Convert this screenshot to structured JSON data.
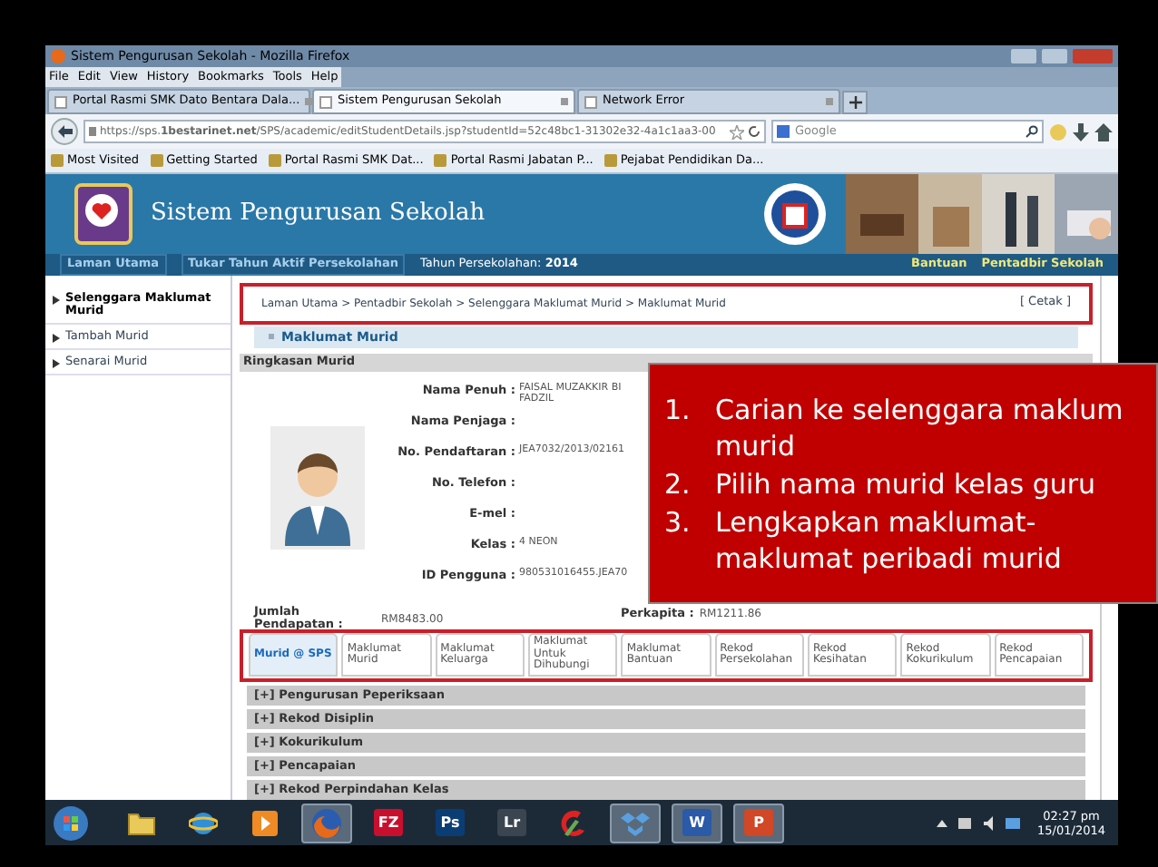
{
  "window": {
    "title": "Sistem Pengurusan Sekolah - Mozilla Firefox"
  },
  "menu": [
    "File",
    "Edit",
    "View",
    "History",
    "Bookmarks",
    "Tools",
    "Help"
  ],
  "browser_tabs": [
    {
      "label": "Portal Rasmi SMK Dato Bentara Dala...",
      "selected": false
    },
    {
      "label": "Sistem Pengurusan Sekolah",
      "selected": true
    },
    {
      "label": "Network Error",
      "selected": false
    }
  ],
  "address": {
    "value": "https://sps.**1bestarinet.net**/SPS/academic/editStudentDetails.jsp?studentId=52c48bc1-31302e32-4a1c1aa3-00"
  },
  "search": {
    "placeholder": "Google"
  },
  "bookmarks": [
    "Most Visited",
    "Getting Started",
    "Portal Rasmi SMK Dat...",
    "Portal Rasmi Jabatan P...",
    "Pejabat Pendidikan Da..."
  ],
  "site": {
    "title": "Sistem Pengurusan Sekolah"
  },
  "site_nav": {
    "left": [
      "Laman Utama",
      "Tukar Tahun Aktif Persekolahan"
    ],
    "year_label": "Tahun Persekolahan:",
    "year": "2014",
    "right": [
      "Bantuan",
      "Pentadbir Sekolah"
    ]
  },
  "sidebar": {
    "items": [
      {
        "label": "Selenggara Maklumat Murid",
        "selected": true
      },
      {
        "label": "Tambah Murid",
        "selected": false
      },
      {
        "label": "Senarai Murid",
        "selected": false
      }
    ]
  },
  "breadcrumb": "Laman Utama > Pentadbir Sekolah > Selenggara Maklumat Murid > Maklumat Murid",
  "print_link": "[ Cetak ]",
  "panel": {
    "title": "Maklumat Murid",
    "section": "Ringkasan Murid"
  },
  "fields": [
    {
      "label": "Nama Penuh :",
      "value": "FAISAL MUZAKKIR BI FADZIL"
    },
    {
      "label": "Nama Penjaga :"
    },
    {
      "label": "No. Pendaftaran :",
      "value": "JEA7032/2013/02161"
    },
    {
      "label": "No. Telefon :"
    },
    {
      "label": "E-mel :"
    },
    {
      "label": "Kelas :",
      "value": "4 NEON"
    },
    {
      "label": "ID Pengguna :",
      "value": "980531016455.JEA70"
    }
  ],
  "income": {
    "label": "Jumlah Pendapatan :",
    "value": "RM8483.00",
    "per_capita_label": "Perkapita :",
    "per_capita": "RM1211.86"
  },
  "tabs": [
    {
      "label": "Murid @ SPS",
      "selected": true
    },
    {
      "label": "Maklumat Murid",
      "selected": false
    },
    {
      "label": "Maklumat Keluarga",
      "selected": false
    },
    {
      "label": "Maklumat Untuk Dihubungi",
      "selected": false
    },
    {
      "label": "Maklumat Bantuan",
      "selected": false
    },
    {
      "label": "Rekod Persekolahan",
      "selected": false
    },
    {
      "label": "Rekod Kesihatan",
      "selected": false
    },
    {
      "label": "Rekod Kokurikulum",
      "selected": false
    },
    {
      "label": "Rekod Pencapaian",
      "selected": false
    }
  ],
  "sections": [
    "[+] Pengurusan Peperiksaan",
    "[+] Rekod Disiplin",
    "[+] Kokurikulum",
    "[+] Pencapaian",
    "[+] Rekod Perpindahan Kelas"
  ],
  "callout": {
    "items": [
      {
        "number": "1.",
        "lines": [
          "Carian ke selenggara maklum",
          "murid"
        ]
      },
      {
        "number": "2.",
        "lines": [
          "Pilih nama murid kelas guru"
        ]
      },
      {
        "number": "3.",
        "lines": [
          "Lengkapkan maklumat-",
          "maklumat peribadi murid"
        ]
      }
    ]
  },
  "taskbar": {
    "apps": [
      {
        "kind": "folder",
        "selected": false
      },
      {
        "kind": "globe",
        "selected": false
      },
      {
        "kind": "media",
        "selected": false
      },
      {
        "kind": "fox",
        "selected": true
      },
      {
        "kind": "letters",
        "label": "FZ",
        "color": "#c8102e",
        "selected": false
      },
      {
        "kind": "letters",
        "label": "Ps",
        "color": "#0b3d75",
        "selected": false
      },
      {
        "kind": "letters",
        "label": "Lr",
        "color": "#3a4550",
        "selected": false
      },
      {
        "kind": "brush",
        "selected": false
      },
      {
        "kind": "box",
        "selected": true
      },
      {
        "kind": "letters",
        "label": "W",
        "color": "#2a5aa8",
        "selected": true
      },
      {
        "kind": "letters",
        "label": "P",
        "color": "#d24726",
        "selected": true
      }
    ],
    "time": "02:27 pm",
    "date": "15/01/2014"
  }
}
